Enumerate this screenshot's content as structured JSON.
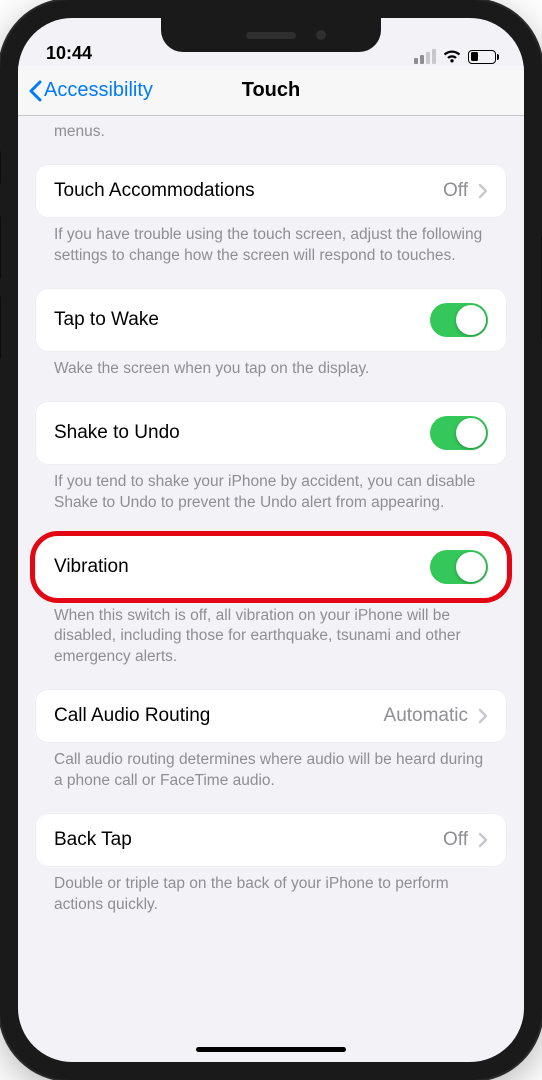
{
  "status": {
    "time": "10:44"
  },
  "nav": {
    "back": "Accessibility",
    "title": "Touch"
  },
  "partial_footer": "menus.",
  "rows": {
    "touch_accommodations": {
      "label": "Touch Accommodations",
      "value": "Off"
    },
    "tap_to_wake": {
      "label": "Tap to Wake"
    },
    "shake_to_undo": {
      "label": "Shake to Undo"
    },
    "vibration": {
      "label": "Vibration"
    },
    "call_audio_routing": {
      "label": "Call Audio Routing",
      "value": "Automatic"
    },
    "back_tap": {
      "label": "Back Tap",
      "value": "Off"
    }
  },
  "footers": {
    "touch_accommodations": "If you have trouble using the touch screen, adjust the following settings to change how the screen will respond to touches.",
    "tap_to_wake": "Wake the screen when you tap on the display.",
    "shake_to_undo": "If you tend to shake your iPhone by accident, you can disable Shake to Undo to prevent the Undo alert from appearing.",
    "vibration": "When this switch is off, all vibration on your iPhone will be disabled, including those for earthquake, tsunami and other emergency alerts.",
    "call_audio_routing": "Call audio routing determines where audio will be heard during a phone call or FaceTime audio.",
    "back_tap": "Double or triple tap on the back of your iPhone to perform actions quickly."
  }
}
